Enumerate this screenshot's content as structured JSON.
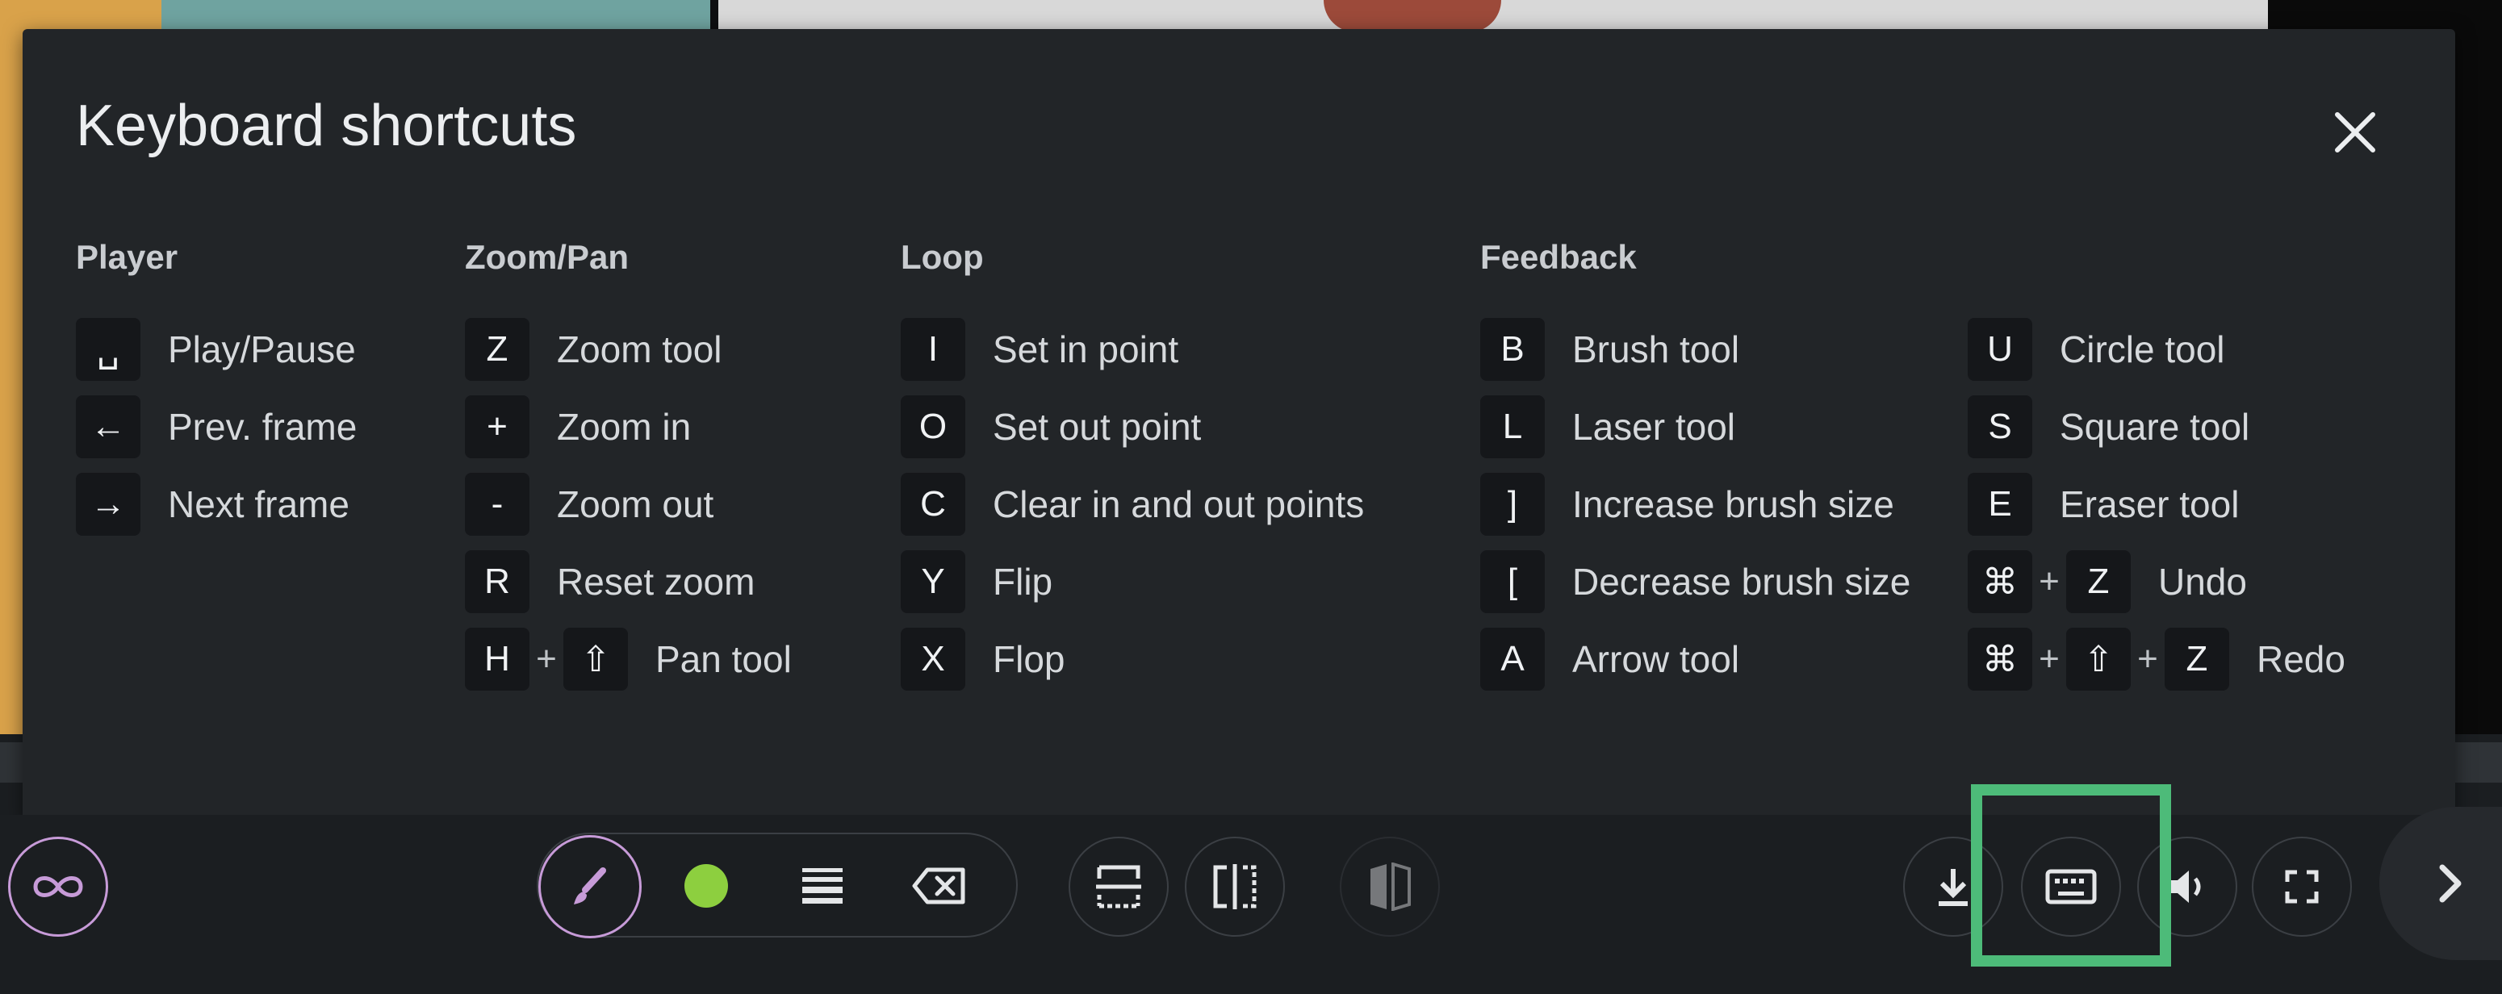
{
  "modal": {
    "title": "Keyboard shortcuts",
    "close_icon": "close-icon",
    "columns": {
      "player": {
        "heading": "Player",
        "rows": [
          {
            "keys": [
              "␣"
            ],
            "label": "Play/Pause"
          },
          {
            "keys": [
              "←"
            ],
            "label": "Prev. frame"
          },
          {
            "keys": [
              "→"
            ],
            "label": "Next frame"
          }
        ]
      },
      "zoom_pan": {
        "heading": "Zoom/Pan",
        "rows": [
          {
            "keys": [
              "Z"
            ],
            "label": "Zoom tool"
          },
          {
            "keys": [
              "+"
            ],
            "label": "Zoom in"
          },
          {
            "keys": [
              "-"
            ],
            "label": "Zoom out"
          },
          {
            "keys": [
              "R"
            ],
            "label": "Reset zoom"
          },
          {
            "keys": [
              "H",
              "⇧"
            ],
            "label": "Pan tool"
          }
        ]
      },
      "loop": {
        "heading": "Loop",
        "rows": [
          {
            "keys": [
              "I"
            ],
            "label": "Set in point"
          },
          {
            "keys": [
              "O"
            ],
            "label": "Set out point"
          },
          {
            "keys": [
              "C"
            ],
            "label": "Clear in and out points"
          },
          {
            "keys": [
              "Y"
            ],
            "label": "Flip"
          },
          {
            "keys": [
              "X"
            ],
            "label": "Flop"
          }
        ]
      },
      "feedback": {
        "heading": "Feedback",
        "rows": [
          {
            "keys": [
              "B"
            ],
            "label": "Brush tool"
          },
          {
            "keys": [
              "L"
            ],
            "label": "Laser tool"
          },
          {
            "keys": [
              "]"
            ],
            "label": "Increase brush size"
          },
          {
            "keys": [
              "["
            ],
            "label": "Decrease brush size"
          },
          {
            "keys": [
              "A"
            ],
            "label": "Arrow tool"
          }
        ]
      },
      "feedback_2": {
        "rows": [
          {
            "keys": [
              "U"
            ],
            "label": "Circle tool"
          },
          {
            "keys": [
              "S"
            ],
            "label": "Square tool"
          },
          {
            "keys": [
              "E"
            ],
            "label": "Eraser tool"
          },
          {
            "keys": [
              "⌘",
              "Z"
            ],
            "label": "Undo"
          },
          {
            "keys": [
              "⌘",
              "⇧",
              "Z"
            ],
            "label": "Redo"
          }
        ]
      }
    },
    "plus_sign": "+"
  },
  "toolbar": {
    "loop_icon": "infinity-loop-icon",
    "brush_icon": "brush-icon",
    "color_icon": "color-swatch-icon",
    "stroke_icon": "stroke-width-icon",
    "clear_icon": "clear-drawing-icon",
    "flip_icon": "flip-icon",
    "flop_icon": "flop-icon",
    "compare_icon": "compare-icon",
    "download_icon": "download-icon",
    "keyboard_icon": "keyboard-icon",
    "volume_icon": "volume-icon",
    "fullscreen_icon": "fullscreen-icon",
    "next_icon": "chevron-right-icon"
  },
  "colors": {
    "accent_purple": "#c79bd8",
    "brush_color": "#8dcf3f",
    "highlight_green": "#4dbb79",
    "modal_bg": "#222528",
    "key_bg": "#15171a"
  }
}
